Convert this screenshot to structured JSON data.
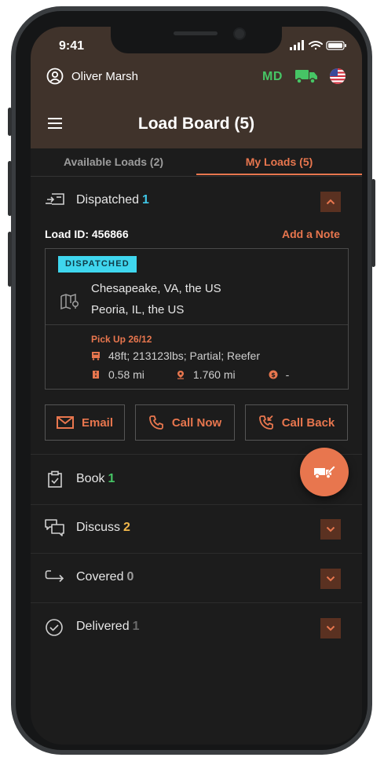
{
  "status_bar": {
    "time": "9:41"
  },
  "user": {
    "name": "Oliver Marsh"
  },
  "region": {
    "state_code": "MD"
  },
  "header": {
    "title": "Load Board (5)"
  },
  "tabs": [
    {
      "label": "Available Loads (2)",
      "active": false
    },
    {
      "label": "My Loads (5)",
      "active": true
    }
  ],
  "sections": {
    "dispatched": {
      "label": "Dispatched",
      "count": "1",
      "count_color": "#3fc6e6",
      "expanded": true
    },
    "book": {
      "label": "Book",
      "count": "1",
      "count_color": "#46c565"
    },
    "discuss": {
      "label": "Discuss",
      "count": "2",
      "count_color": "#f2b84b"
    },
    "covered": {
      "label": "Covered",
      "count": "0",
      "count_color": "#9d9d9d"
    },
    "delivered": {
      "label": "Delivered",
      "count": "1",
      "count_color": "#6a6a6a"
    }
  },
  "load": {
    "id_text": "Load ID: 456866",
    "add_note": "Add a Note",
    "badge": "DISPATCHED",
    "origin": "Chesapeake, VA, the US",
    "destination": "Peoria, IL, the US",
    "pickup": "Pick Up 26/12",
    "specs": "48ft; 213123lbs; Partial; Reefer",
    "distance_deadhead": "0.58 mi",
    "distance_total": "1.760 mi",
    "rate": "-"
  },
  "actions": {
    "email": "Email",
    "call_now": "Call Now",
    "call_back": "Call Back"
  },
  "colors": {
    "accent": "#e8764e",
    "header_bg": "#40332b",
    "screen_bg": "#1c1c1c",
    "badge_bg": "#3fd6ee",
    "md_green": "#46c565"
  }
}
